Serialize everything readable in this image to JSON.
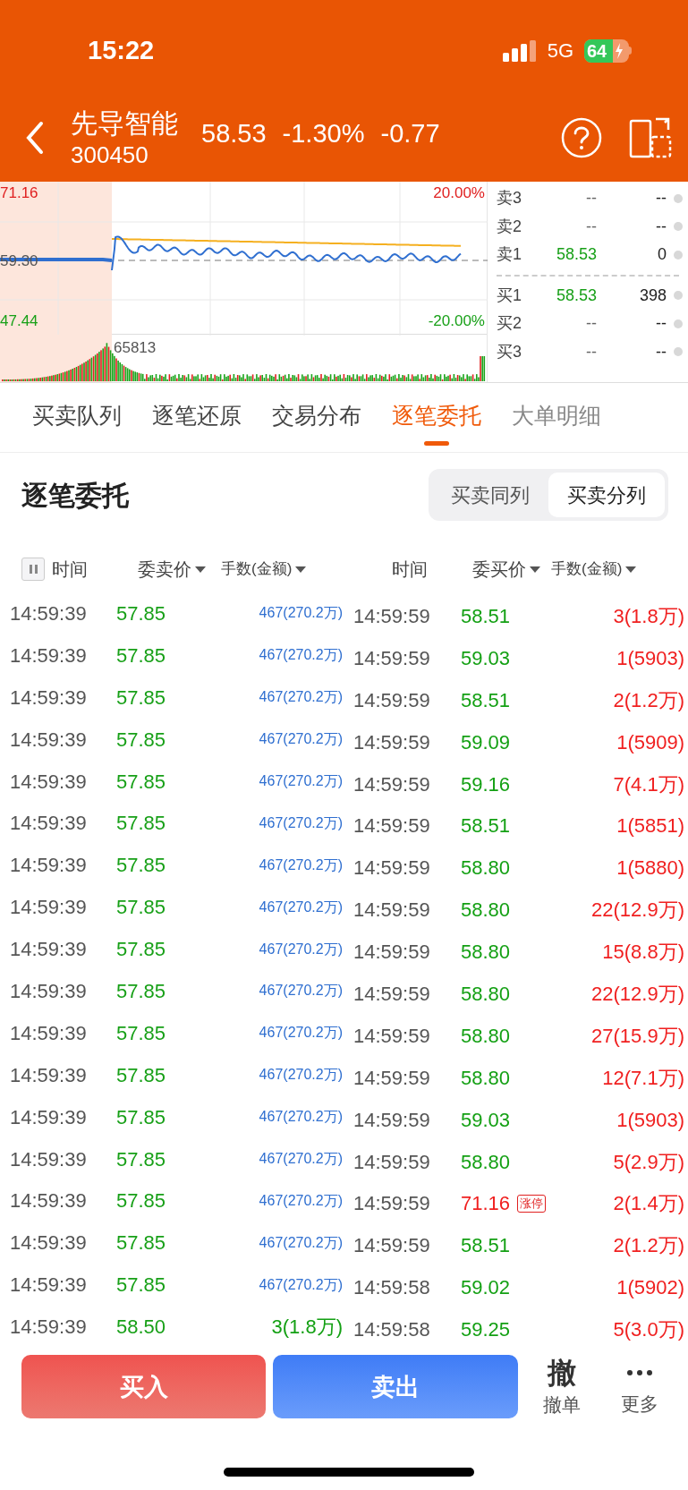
{
  "status_bar": {
    "time": "15:22",
    "network": "5G",
    "battery": "64"
  },
  "header": {
    "name": "先导智能",
    "code": "300450",
    "price": "58.53",
    "change_pct": "-1.30%",
    "change": "-0.77"
  },
  "chart": {
    "high": "71.16",
    "prev_close": "59.30",
    "low": "47.44",
    "up_pct": "20.00%",
    "down_pct": "-20.00%",
    "volume_peak": "65813"
  },
  "order_book": {
    "asks": [
      {
        "label": "卖3",
        "price": "--",
        "volume": "--"
      },
      {
        "label": "卖2",
        "price": "--",
        "volume": "--"
      },
      {
        "label": "卖1",
        "price": "58.53",
        "volume": "0"
      }
    ],
    "bids": [
      {
        "label": "买1",
        "price": "58.53",
        "volume": "398"
      },
      {
        "label": "买2",
        "price": "--",
        "volume": "--"
      },
      {
        "label": "买3",
        "price": "--",
        "volume": "--"
      }
    ]
  },
  "tabs": [
    {
      "label": "买卖队列",
      "selected": false
    },
    {
      "label": "逐笔还原",
      "selected": false
    },
    {
      "label": "交易分布",
      "selected": false
    },
    {
      "label": "逐笔委托",
      "selected": true
    },
    {
      "label": "大单明细",
      "selected": false
    }
  ],
  "section_title": "逐笔委托",
  "view_toggle": [
    {
      "label": "买卖同列",
      "selected": false
    },
    {
      "label": "买卖分列",
      "selected": true
    }
  ],
  "columns": [
    {
      "label": "时间",
      "sortable": false
    },
    {
      "label": "委卖价",
      "sortable": true
    },
    {
      "label": "手数(金额)",
      "sortable": true
    },
    {
      "label": "时间",
      "sortable": false
    },
    {
      "label": "委买价",
      "sortable": true
    },
    {
      "label": "手数(金额)",
      "sortable": true
    }
  ],
  "rows": [
    {
      "sell": {
        "time": "14:59:39",
        "price": "57.85",
        "volume": "467(270.2万)",
        "color": "#2f6fd0"
      },
      "buy": {
        "time": "14:59:59",
        "price": "58.51",
        "volume": "3(1.8万)",
        "color": "#14a014"
      }
    },
    {
      "sell": {
        "time": "14:59:39",
        "price": "57.85",
        "volume": "467(270.2万)",
        "color": "#2f6fd0"
      },
      "buy": {
        "time": "14:59:59",
        "price": "59.03",
        "volume": "1(5903)",
        "color": "#14a014"
      }
    },
    {
      "sell": {
        "time": "14:59:39",
        "price": "57.85",
        "volume": "467(270.2万)",
        "color": "#2f6fd0"
      },
      "buy": {
        "time": "14:59:59",
        "price": "58.51",
        "volume": "2(1.2万)",
        "color": "#14a014"
      }
    },
    {
      "sell": {
        "time": "14:59:39",
        "price": "57.85",
        "volume": "467(270.2万)",
        "color": "#2f6fd0"
      },
      "buy": {
        "time": "14:59:59",
        "price": "59.09",
        "volume": "1(5909)",
        "color": "#14a014"
      }
    },
    {
      "sell": {
        "time": "14:59:39",
        "price": "57.85",
        "volume": "467(270.2万)",
        "color": "#2f6fd0"
      },
      "buy": {
        "time": "14:59:59",
        "price": "59.16",
        "volume": "7(4.1万)",
        "color": "#14a014"
      }
    },
    {
      "sell": {
        "time": "14:59:39",
        "price": "57.85",
        "volume": "467(270.2万)",
        "color": "#2f6fd0"
      },
      "buy": {
        "time": "14:59:59",
        "price": "58.51",
        "volume": "1(5851)",
        "color": "#14a014"
      }
    },
    {
      "sell": {
        "time": "14:59:39",
        "price": "57.85",
        "volume": "467(270.2万)",
        "color": "#2f6fd0"
      },
      "buy": {
        "time": "14:59:59",
        "price": "58.80",
        "volume": "1(5880)",
        "color": "#14a014"
      }
    },
    {
      "sell": {
        "time": "14:59:39",
        "price": "57.85",
        "volume": "467(270.2万)",
        "color": "#2f6fd0"
      },
      "buy": {
        "time": "14:59:59",
        "price": "58.80",
        "volume": "22(12.9万)",
        "color": "#14a014"
      }
    },
    {
      "sell": {
        "time": "14:59:39",
        "price": "57.85",
        "volume": "467(270.2万)",
        "color": "#2f6fd0"
      },
      "buy": {
        "time": "14:59:59",
        "price": "58.80",
        "volume": "15(8.8万)",
        "color": "#14a014"
      }
    },
    {
      "sell": {
        "time": "14:59:39",
        "price": "57.85",
        "volume": "467(270.2万)",
        "color": "#2f6fd0"
      },
      "buy": {
        "time": "14:59:59",
        "price": "58.80",
        "volume": "22(12.9万)",
        "color": "#14a014"
      }
    },
    {
      "sell": {
        "time": "14:59:39",
        "price": "57.85",
        "volume": "467(270.2万)",
        "color": "#2f6fd0"
      },
      "buy": {
        "time": "14:59:59",
        "price": "58.80",
        "volume": "27(15.9万)",
        "color": "#14a014"
      }
    },
    {
      "sell": {
        "time": "14:59:39",
        "price": "57.85",
        "volume": "467(270.2万)",
        "color": "#2f6fd0"
      },
      "buy": {
        "time": "14:59:59",
        "price": "58.80",
        "volume": "12(7.1万)",
        "color": "#14a014"
      }
    },
    {
      "sell": {
        "time": "14:59:39",
        "price": "57.85",
        "volume": "467(270.2万)",
        "color": "#2f6fd0"
      },
      "buy": {
        "time": "14:59:59",
        "price": "59.03",
        "volume": "1(5903)",
        "color": "#14a014"
      }
    },
    {
      "sell": {
        "time": "14:59:39",
        "price": "57.85",
        "volume": "467(270.2万)",
        "color": "#2f6fd0"
      },
      "buy": {
        "time": "14:59:59",
        "price": "58.80",
        "volume": "5(2.9万)",
        "color": "#14a014"
      }
    },
    {
      "sell": {
        "time": "14:59:39",
        "price": "57.85",
        "volume": "467(270.2万)",
        "color": "#2f6fd0"
      },
      "buy": {
        "time": "14:59:59",
        "price": "71.16",
        "badge": "涨停",
        "volume": "2(1.4万)",
        "color": "#f02020"
      }
    },
    {
      "sell": {
        "time": "14:59:39",
        "price": "57.85",
        "volume": "467(270.2万)",
        "color": "#2f6fd0"
      },
      "buy": {
        "time": "14:59:59",
        "price": "58.51",
        "volume": "2(1.2万)",
        "color": "#14a014"
      }
    },
    {
      "sell": {
        "time": "14:59:39",
        "price": "57.85",
        "volume": "467(270.2万)",
        "color": "#2f6fd0"
      },
      "buy": {
        "time": "14:59:58",
        "price": "59.02",
        "volume": "1(5902)",
        "color": "#14a014"
      }
    },
    {
      "sell": {
        "time": "14:59:39",
        "price": "58.50",
        "volume": "3(1.8万)",
        "color": "#14a014"
      },
      "buy": {
        "time": "14:59:58",
        "price": "59.25",
        "volume": "5(3.0万)",
        "color": "#14a014"
      }
    }
  ],
  "actions": {
    "buy": "买入",
    "sell": "卖出",
    "cancel_icon": "撤",
    "cancel": "撤单",
    "more": "更多"
  }
}
